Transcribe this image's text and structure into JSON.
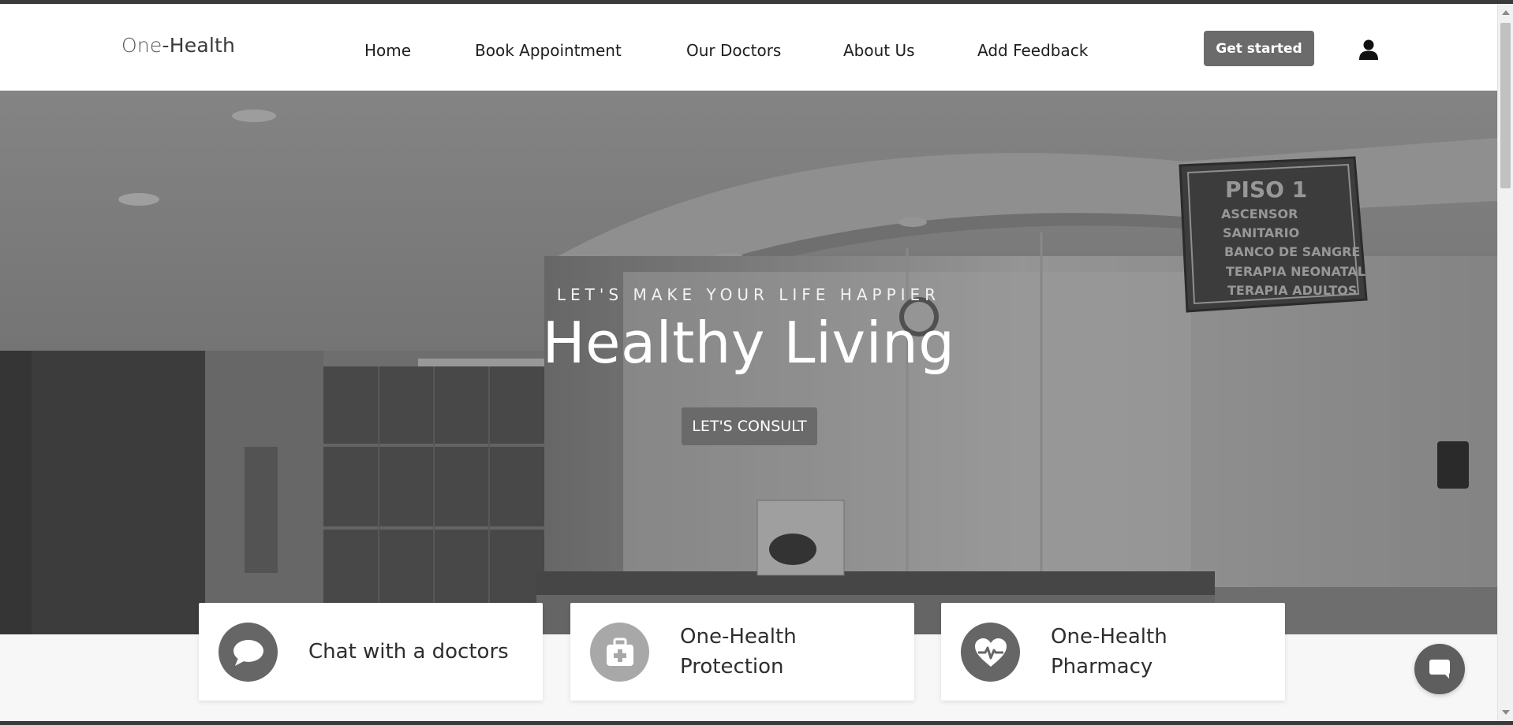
{
  "brand": {
    "name_part1": "One",
    "name_part2": "-Health"
  },
  "nav": {
    "items": [
      {
        "label": "Home"
      },
      {
        "label": "Book Appointment"
      },
      {
        "label": "Our Doctors"
      },
      {
        "label": "About Us"
      },
      {
        "label": "Add Feedback"
      }
    ],
    "cta_label": "Get started",
    "user_icon": "user-icon"
  },
  "hero": {
    "subtitle": "LET'S MAKE YOUR LIFE HAPPIER",
    "title": "Healthy Living",
    "button_label": "LET'S CONSULT",
    "sign": {
      "heading": "PISO 1",
      "lines": [
        "ASCENSOR",
        "SANITARIO",
        "BANCO DE SANGRE",
        "TERAPIA NEONATAL",
        "TERAPIA ADULTOS"
      ]
    }
  },
  "features": [
    {
      "icon": "speech-bubble-icon",
      "label": "Chat with a doctors"
    },
    {
      "icon": "medical-kit-icon",
      "label_line1": "One-Health",
      "label_line2": "Protection"
    },
    {
      "icon": "heartbeat-icon",
      "label_line1": "One-Health",
      "label_line2": "Pharmacy"
    }
  ],
  "chat_widget": {
    "icon": "chat-icon"
  },
  "colors": {
    "navbar_bg": "#ffffff",
    "button_bg": "#6b6b6b",
    "card_bg": "#ffffff",
    "icon_circle": "#666666"
  }
}
